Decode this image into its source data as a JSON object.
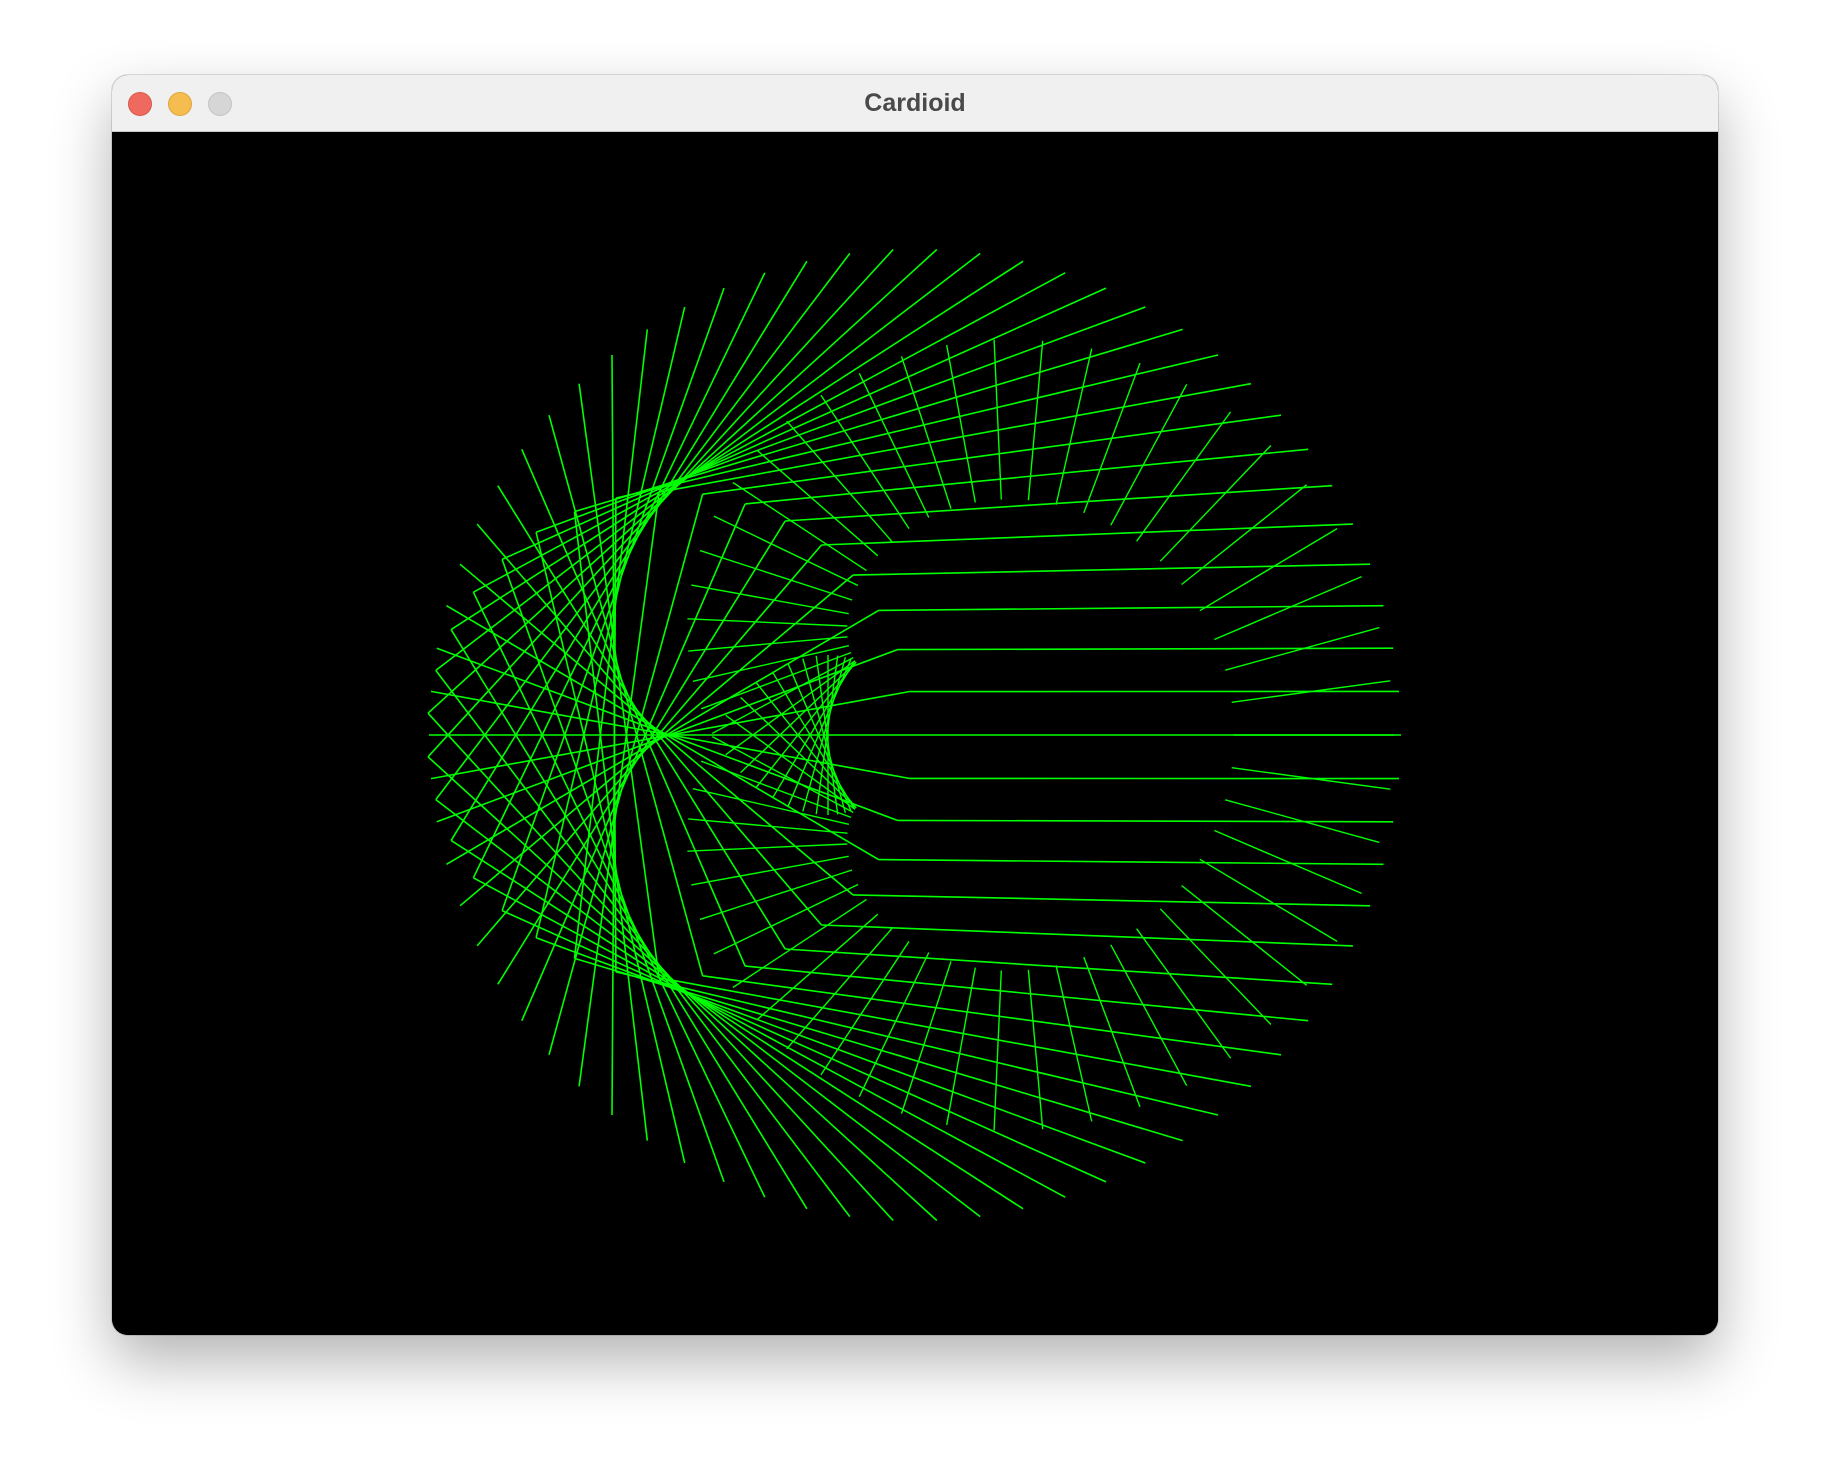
{
  "window": {
    "title": "Cardioid",
    "controls": [
      "close",
      "minimize",
      "zoom"
    ]
  },
  "canvas": {
    "background": "#000000",
    "line_color": "#00ff00",
    "figure": "cardioid",
    "line_count": 70,
    "multiplier": 2
  }
}
